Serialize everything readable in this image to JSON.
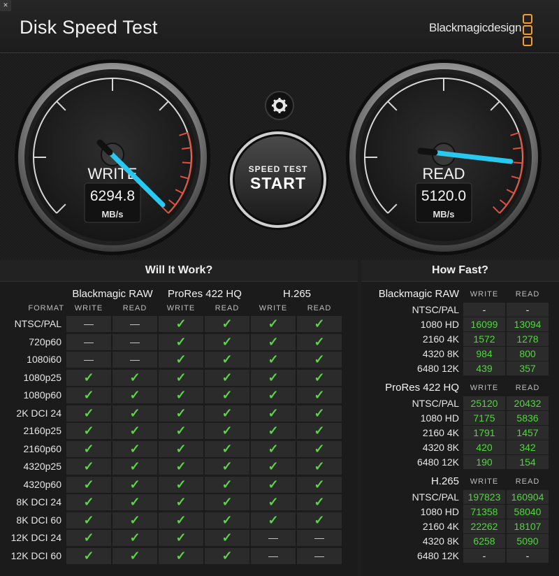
{
  "header": {
    "title": "Disk Speed Test",
    "brand": "Blackmagicdesign",
    "close": "×"
  },
  "gauges": {
    "write": {
      "label": "WRITE",
      "value": "6294.8",
      "unit": "MB/s"
    },
    "read": {
      "label": "READ",
      "value": "5120.0",
      "unit": "MB/s"
    },
    "start_button": {
      "line1": "SPEED TEST",
      "line2": "START"
    }
  },
  "will_it_work": {
    "title": "Will It Work?",
    "format_label": "FORMAT",
    "codecs": [
      "Blackmagic RAW",
      "ProRes 422 HQ",
      "H.265"
    ],
    "subcols": [
      "WRITE",
      "READ"
    ],
    "rows": [
      {
        "format": "NTSC/PAL",
        "cells": [
          "dash",
          "dash",
          "check",
          "check",
          "check",
          "check"
        ]
      },
      {
        "format": "720p60",
        "cells": [
          "dash",
          "dash",
          "check",
          "check",
          "check",
          "check"
        ]
      },
      {
        "format": "1080i60",
        "cells": [
          "dash",
          "dash",
          "check",
          "check",
          "check",
          "check"
        ]
      },
      {
        "format": "1080p25",
        "cells": [
          "check",
          "check",
          "check",
          "check",
          "check",
          "check"
        ]
      },
      {
        "format": "1080p60",
        "cells": [
          "check",
          "check",
          "check",
          "check",
          "check",
          "check"
        ]
      },
      {
        "format": "2K DCI 24",
        "cells": [
          "check",
          "check",
          "check",
          "check",
          "check",
          "check"
        ]
      },
      {
        "format": "2160p25",
        "cells": [
          "check",
          "check",
          "check",
          "check",
          "check",
          "check"
        ]
      },
      {
        "format": "2160p60",
        "cells": [
          "check",
          "check",
          "check",
          "check",
          "check",
          "check"
        ]
      },
      {
        "format": "4320p25",
        "cells": [
          "check",
          "check",
          "check",
          "check",
          "check",
          "check"
        ]
      },
      {
        "format": "4320p60",
        "cells": [
          "check",
          "check",
          "check",
          "check",
          "check",
          "check"
        ]
      },
      {
        "format": "8K DCI 24",
        "cells": [
          "check",
          "check",
          "check",
          "check",
          "check",
          "check"
        ]
      },
      {
        "format": "8K DCI 60",
        "cells": [
          "check",
          "check",
          "check",
          "check",
          "check",
          "check"
        ]
      },
      {
        "format": "12K DCI 24",
        "cells": [
          "check",
          "check",
          "check",
          "check",
          "dash",
          "dash"
        ]
      },
      {
        "format": "12K DCI 60",
        "cells": [
          "check",
          "check",
          "check",
          "check",
          "dash",
          "dash"
        ]
      }
    ]
  },
  "how_fast": {
    "title": "How Fast?",
    "subcols": [
      "WRITE",
      "READ"
    ],
    "groups": [
      {
        "codec": "Blackmagic RAW",
        "rows": [
          {
            "format": "NTSC/PAL",
            "write": "-",
            "read": "-"
          },
          {
            "format": "1080 HD",
            "write": "16099",
            "read": "13094"
          },
          {
            "format": "2160 4K",
            "write": "1572",
            "read": "1278"
          },
          {
            "format": "4320 8K",
            "write": "984",
            "read": "800"
          },
          {
            "format": "6480 12K",
            "write": "439",
            "read": "357"
          }
        ]
      },
      {
        "codec": "ProRes 422 HQ",
        "rows": [
          {
            "format": "NTSC/PAL",
            "write": "25120",
            "read": "20432"
          },
          {
            "format": "1080 HD",
            "write": "7175",
            "read": "5836"
          },
          {
            "format": "2160 4K",
            "write": "1791",
            "read": "1457"
          },
          {
            "format": "4320 8K",
            "write": "420",
            "read": "342"
          },
          {
            "format": "6480 12K",
            "write": "190",
            "read": "154"
          }
        ]
      },
      {
        "codec": "H.265",
        "rows": [
          {
            "format": "NTSC/PAL",
            "write": "197823",
            "read": "160904"
          },
          {
            "format": "1080 HD",
            "write": "71358",
            "read": "58040"
          },
          {
            "format": "2160 4K",
            "write": "22262",
            "read": "18107"
          },
          {
            "format": "4320 8K",
            "write": "6258",
            "read": "5090"
          },
          {
            "format": "6480 12K",
            "write": "-",
            "read": "-"
          }
        ]
      }
    ]
  },
  "colors": {
    "accent": "#f0a030",
    "needle": "#29c8f0",
    "ok": "#5cd647",
    "redline": "#e0503a"
  }
}
